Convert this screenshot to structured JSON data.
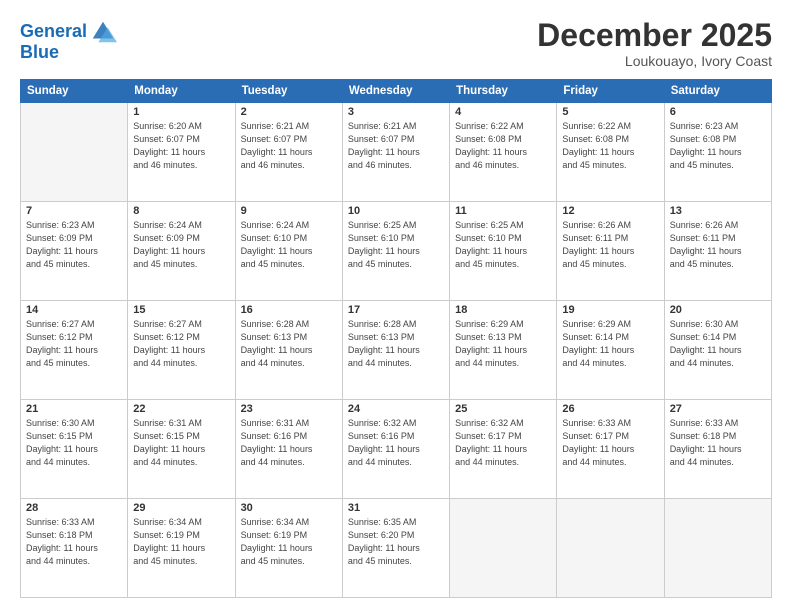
{
  "header": {
    "logo_line1": "General",
    "logo_line2": "Blue",
    "month": "December 2025",
    "location": "Loukouayo, Ivory Coast"
  },
  "weekdays": [
    "Sunday",
    "Monday",
    "Tuesday",
    "Wednesday",
    "Thursday",
    "Friday",
    "Saturday"
  ],
  "weeks": [
    [
      {
        "day": "",
        "info": ""
      },
      {
        "day": "1",
        "info": "Sunrise: 6:20 AM\nSunset: 6:07 PM\nDaylight: 11 hours\nand 46 minutes."
      },
      {
        "day": "2",
        "info": "Sunrise: 6:21 AM\nSunset: 6:07 PM\nDaylight: 11 hours\nand 46 minutes."
      },
      {
        "day": "3",
        "info": "Sunrise: 6:21 AM\nSunset: 6:07 PM\nDaylight: 11 hours\nand 46 minutes."
      },
      {
        "day": "4",
        "info": "Sunrise: 6:22 AM\nSunset: 6:08 PM\nDaylight: 11 hours\nand 46 minutes."
      },
      {
        "day": "5",
        "info": "Sunrise: 6:22 AM\nSunset: 6:08 PM\nDaylight: 11 hours\nand 45 minutes."
      },
      {
        "day": "6",
        "info": "Sunrise: 6:23 AM\nSunset: 6:08 PM\nDaylight: 11 hours\nand 45 minutes."
      }
    ],
    [
      {
        "day": "7",
        "info": "Sunrise: 6:23 AM\nSunset: 6:09 PM\nDaylight: 11 hours\nand 45 minutes."
      },
      {
        "day": "8",
        "info": "Sunrise: 6:24 AM\nSunset: 6:09 PM\nDaylight: 11 hours\nand 45 minutes."
      },
      {
        "day": "9",
        "info": "Sunrise: 6:24 AM\nSunset: 6:10 PM\nDaylight: 11 hours\nand 45 minutes."
      },
      {
        "day": "10",
        "info": "Sunrise: 6:25 AM\nSunset: 6:10 PM\nDaylight: 11 hours\nand 45 minutes."
      },
      {
        "day": "11",
        "info": "Sunrise: 6:25 AM\nSunset: 6:10 PM\nDaylight: 11 hours\nand 45 minutes."
      },
      {
        "day": "12",
        "info": "Sunrise: 6:26 AM\nSunset: 6:11 PM\nDaylight: 11 hours\nand 45 minutes."
      },
      {
        "day": "13",
        "info": "Sunrise: 6:26 AM\nSunset: 6:11 PM\nDaylight: 11 hours\nand 45 minutes."
      }
    ],
    [
      {
        "day": "14",
        "info": "Sunrise: 6:27 AM\nSunset: 6:12 PM\nDaylight: 11 hours\nand 45 minutes."
      },
      {
        "day": "15",
        "info": "Sunrise: 6:27 AM\nSunset: 6:12 PM\nDaylight: 11 hours\nand 44 minutes."
      },
      {
        "day": "16",
        "info": "Sunrise: 6:28 AM\nSunset: 6:13 PM\nDaylight: 11 hours\nand 44 minutes."
      },
      {
        "day": "17",
        "info": "Sunrise: 6:28 AM\nSunset: 6:13 PM\nDaylight: 11 hours\nand 44 minutes."
      },
      {
        "day": "18",
        "info": "Sunrise: 6:29 AM\nSunset: 6:13 PM\nDaylight: 11 hours\nand 44 minutes."
      },
      {
        "day": "19",
        "info": "Sunrise: 6:29 AM\nSunset: 6:14 PM\nDaylight: 11 hours\nand 44 minutes."
      },
      {
        "day": "20",
        "info": "Sunrise: 6:30 AM\nSunset: 6:14 PM\nDaylight: 11 hours\nand 44 minutes."
      }
    ],
    [
      {
        "day": "21",
        "info": "Sunrise: 6:30 AM\nSunset: 6:15 PM\nDaylight: 11 hours\nand 44 minutes."
      },
      {
        "day": "22",
        "info": "Sunrise: 6:31 AM\nSunset: 6:15 PM\nDaylight: 11 hours\nand 44 minutes."
      },
      {
        "day": "23",
        "info": "Sunrise: 6:31 AM\nSunset: 6:16 PM\nDaylight: 11 hours\nand 44 minutes."
      },
      {
        "day": "24",
        "info": "Sunrise: 6:32 AM\nSunset: 6:16 PM\nDaylight: 11 hours\nand 44 minutes."
      },
      {
        "day": "25",
        "info": "Sunrise: 6:32 AM\nSunset: 6:17 PM\nDaylight: 11 hours\nand 44 minutes."
      },
      {
        "day": "26",
        "info": "Sunrise: 6:33 AM\nSunset: 6:17 PM\nDaylight: 11 hours\nand 44 minutes."
      },
      {
        "day": "27",
        "info": "Sunrise: 6:33 AM\nSunset: 6:18 PM\nDaylight: 11 hours\nand 44 minutes."
      }
    ],
    [
      {
        "day": "28",
        "info": "Sunrise: 6:33 AM\nSunset: 6:18 PM\nDaylight: 11 hours\nand 44 minutes."
      },
      {
        "day": "29",
        "info": "Sunrise: 6:34 AM\nSunset: 6:19 PM\nDaylight: 11 hours\nand 45 minutes."
      },
      {
        "day": "30",
        "info": "Sunrise: 6:34 AM\nSunset: 6:19 PM\nDaylight: 11 hours\nand 45 minutes."
      },
      {
        "day": "31",
        "info": "Sunrise: 6:35 AM\nSunset: 6:20 PM\nDaylight: 11 hours\nand 45 minutes."
      },
      {
        "day": "",
        "info": ""
      },
      {
        "day": "",
        "info": ""
      },
      {
        "day": "",
        "info": ""
      }
    ]
  ]
}
